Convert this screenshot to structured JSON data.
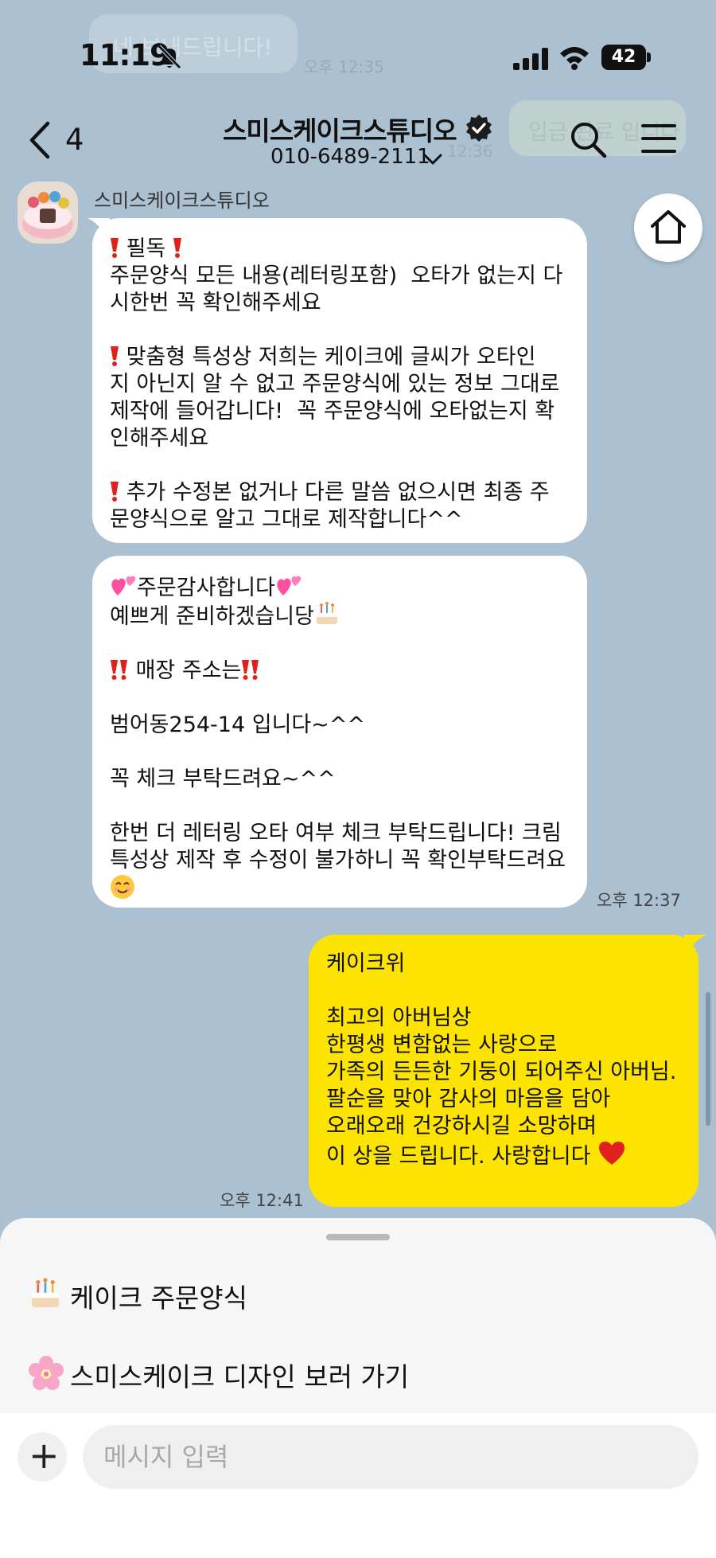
{
  "background_ghost": {
    "bubble_text": "네 보내드립니다!",
    "time": "오후 12:35",
    "right_bubble_text": "입금 완료 입니다",
    "right_time": "12:36"
  },
  "status_bar": {
    "time": "11:19",
    "battery": "42"
  },
  "header": {
    "back_count": "4",
    "title": "스미스케이크스튜디오",
    "phone": "010-6489-2111"
  },
  "sender": {
    "name": "스미스케이크스튜디오"
  },
  "messages": {
    "m1": {
      "l1": " 필독 ",
      "l2": "주문양식 모든 내용(레터링포함)  오타가 없는지 다\n시한번 꼭 확인해주세요",
      "l3": " 맞춤형 특성상 저희는 케이크에 글씨가 오타인\n지 아닌지 알 수 없고 주문양식에 있는 정보 그대로\n제작에 들어갑니다!  꼭 주문양식에 오타없는지 확\n인해주세요",
      "l4": " 추가 수정본 없거나 다른 말씀 없으시면 최종 주\n문양식으로 알고 그대로 제작합니다^^"
    },
    "m2": {
      "l1": "주문감사합니다",
      "l2": "예쁘게 준비하겠습니당",
      "l3": "매장 주소는",
      "l4": "범어동254-14 입니다~^^",
      "l5": "꼭 체크 부탁드려요~^^",
      "l6": "한번 더 레터링 오타 여부 체크 부탁드립니다! 크림\n특성상 제작 후 수정이 불가하니 꼭 확인부탁드려요"
    },
    "received_time": "오후 12:37",
    "mine": {
      "text_a": "케이크위\n\n최고의 아버님상\n한평생 변함없는 사랑으로\n가족의 든든한 기둥이 되어주신 아버님.\n팔순을 맞아 감사의 마음을 담아\n오래오래 건강하시길 소망하며\n",
      "text_b": "이 상을 드립니다. 사랑합니다 "
    },
    "sent_time": "오후 12:41"
  },
  "quick_menu": {
    "item1": "케이크 주문양식",
    "item2": "스미스케이크 디자인 보러 가기"
  },
  "composer": {
    "placeholder": "메시지 입력"
  },
  "colors": {
    "chat_bg": "#abc1d1",
    "my_bubble": "#fde300",
    "their_bubble": "#ffffff",
    "exclaim_red": "#e0201a",
    "heart_pink": "#ff4fa0"
  }
}
